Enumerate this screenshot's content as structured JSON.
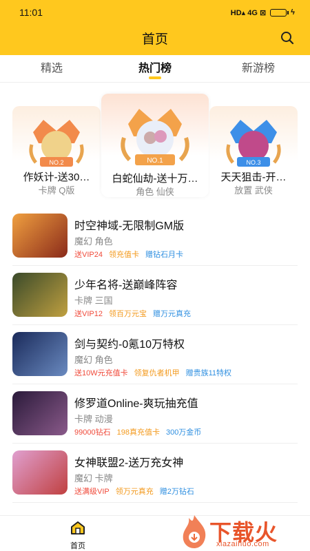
{
  "status_bar": {
    "time": "11:01",
    "indicators": "HD▴ 4G ⊠"
  },
  "header": {
    "title": "首页",
    "search_icon": "search-icon"
  },
  "tabs": [
    {
      "label": "精选",
      "active": false
    },
    {
      "label": "热门榜",
      "active": true
    },
    {
      "label": "新游榜",
      "active": false
    }
  ],
  "podium": [
    {
      "rank_label": "NO.2",
      "name": "作妖计-送30…",
      "tags": "卡牌 Q版"
    },
    {
      "rank_label": "NO.1",
      "name": "白蛇仙劫-送十万…",
      "tags": "角色 仙侠"
    },
    {
      "rank_label": "NO.3",
      "name": "天天狙击-开…",
      "tags": "放置 武侠"
    }
  ],
  "games": [
    {
      "name": "时空神域-无限制GM版",
      "tags": "魔幻 角色",
      "benefits": [
        "送VIP24",
        "领充值卡",
        "赠钻石月卡"
      ],
      "thumb_color": "#c86a2a"
    },
    {
      "name": "少年名将-送巅峰阵容",
      "tags": "卡牌 三国",
      "benefits": [
        "送VIP12",
        "领百万元宝",
        "赠万元真充"
      ],
      "thumb_color": "#4a5a2a"
    },
    {
      "name": "剑与契约-0氪10万特权",
      "tags": "魔幻 角色",
      "benefits": [
        "送10W元充值卡",
        "领复仇者机甲",
        "赠贵族11特权"
      ],
      "thumb_color": "#2a4a8a"
    },
    {
      "name": "修罗道Online-爽玩抽充值",
      "tags": "卡牌 动漫",
      "benefits": [
        "99000钻石",
        "198真充值卡",
        "300万金币"
      ],
      "thumb_color": "#5a3a6a"
    },
    {
      "name": "女神联盟2-送万充女神",
      "tags": "魔幻 卡牌",
      "benefits": [
        "送满级VIP",
        "领万元真充",
        "赠2万钻石"
      ],
      "thumb_color": "#b85a9a"
    }
  ],
  "bottom_nav": {
    "home_label": "首页"
  },
  "watermark": {
    "text": "下载火",
    "sub": "xiazaihuo.com"
  },
  "colors": {
    "brand": "#FFC81E",
    "benefit_red": "#F04A3A",
    "benefit_orange": "#F39A1E",
    "benefit_blue": "#2F8FE0"
  }
}
